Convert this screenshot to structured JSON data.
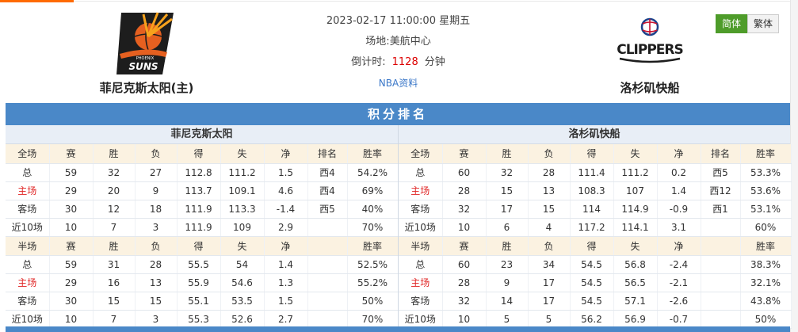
{
  "match": {
    "datetime": "2023-02-17 11:00:00 星期五",
    "venue_label": "场地:",
    "venue": "美航中心",
    "countdown_label": "倒计时:",
    "countdown_value": "1128",
    "countdown_unit": "分钟",
    "nba_link": "NBA资料"
  },
  "home_team": {
    "name": "菲尼克斯太阳(主)",
    "logo_text_1": "PHOENIX",
    "logo_text_2": "SUNS"
  },
  "away_team": {
    "name": "洛杉矶快船",
    "logo_text": "CLIPPERS"
  },
  "lang": {
    "simplified": "简体",
    "traditional": "繁体"
  },
  "section_title": "积分排名",
  "colors": {
    "header_blue": "#4a88c8",
    "accent_red": "#e02424",
    "lang_active": "#4e9c2a"
  },
  "standings": [
    {
      "team": "菲尼克斯太阳",
      "full_header": [
        "全场",
        "赛",
        "胜",
        "负",
        "得",
        "失",
        "净",
        "排名",
        "胜率"
      ],
      "full_rows": [
        [
          "总",
          "59",
          "32",
          "27",
          "112.8",
          "111.2",
          "1.5",
          "西4",
          "54.2%"
        ],
        [
          "主场",
          "29",
          "20",
          "9",
          "113.7",
          "109.1",
          "4.6",
          "西4",
          "69%"
        ],
        [
          "客场",
          "30",
          "12",
          "18",
          "111.9",
          "113.3",
          "-1.4",
          "西5",
          "40%"
        ],
        [
          "近10场",
          "10",
          "7",
          "3",
          "111.9",
          "109",
          "2.9",
          "",
          "70%"
        ]
      ],
      "half_header": [
        "半场",
        "赛",
        "胜",
        "负",
        "得",
        "失",
        "净",
        "",
        "胜率"
      ],
      "half_rows": [
        [
          "总",
          "59",
          "31",
          "28",
          "55.5",
          "54",
          "1.4",
          "",
          "52.5%"
        ],
        [
          "主场",
          "29",
          "16",
          "13",
          "55.9",
          "54.6",
          "1.3",
          "",
          "55.2%"
        ],
        [
          "客场",
          "30",
          "15",
          "15",
          "55.1",
          "53.5",
          "1.5",
          "",
          "50%"
        ],
        [
          "近10场",
          "10",
          "7",
          "3",
          "55.3",
          "52.6",
          "2.7",
          "",
          "70%"
        ]
      ]
    },
    {
      "team": "洛杉矶快船",
      "full_header": [
        "全场",
        "赛",
        "胜",
        "负",
        "得",
        "失",
        "净",
        "排名",
        "胜率"
      ],
      "full_rows": [
        [
          "总",
          "60",
          "32",
          "28",
          "111.4",
          "111.2",
          "0.2",
          "西5",
          "53.3%"
        ],
        [
          "主场",
          "28",
          "15",
          "13",
          "108.3",
          "107",
          "1.4",
          "西12",
          "53.6%"
        ],
        [
          "客场",
          "32",
          "17",
          "15",
          "114",
          "114.9",
          "-0.9",
          "西1",
          "53.1%"
        ],
        [
          "近10场",
          "10",
          "6",
          "4",
          "117.2",
          "114.1",
          "3.1",
          "",
          "60%"
        ]
      ],
      "half_header": [
        "半场",
        "赛",
        "胜",
        "负",
        "得",
        "失",
        "净",
        "",
        "胜率"
      ],
      "half_rows": [
        [
          "总",
          "60",
          "23",
          "34",
          "54.5",
          "56.8",
          "-2.4",
          "",
          "38.3%"
        ],
        [
          "主场",
          "28",
          "9",
          "17",
          "54.5",
          "56.5",
          "-2.1",
          "",
          "32.1%"
        ],
        [
          "客场",
          "32",
          "14",
          "17",
          "54.5",
          "57.1",
          "-2.6",
          "",
          "43.8%"
        ],
        [
          "近10场",
          "10",
          "5",
          "5",
          "56.2",
          "56.9",
          "-0.7",
          "",
          "50%"
        ]
      ]
    }
  ]
}
